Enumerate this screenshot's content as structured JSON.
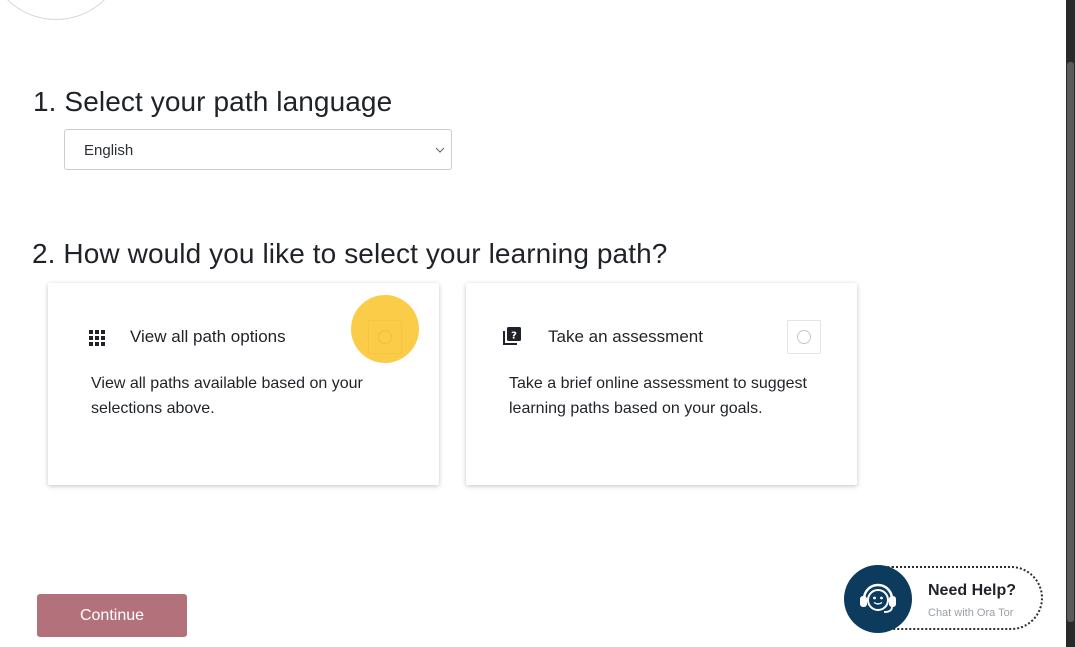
{
  "section1": {
    "title": "1. Select your path language",
    "language_select": {
      "value": "English"
    }
  },
  "section2": {
    "title": "2. How would you like to select your learning path?",
    "options": [
      {
        "title": "View all path options",
        "description": "View all paths available based on your selections above.",
        "icon": "grid-icon",
        "selected": false
      },
      {
        "title": "Take an assessment",
        "description": "Take a brief online assessment to suggest learning paths based on your goals.",
        "icon": "question-book-icon",
        "selected": false
      }
    ]
  },
  "actions": {
    "continue_label": "Continue"
  },
  "help": {
    "title": "Need Help?",
    "subtitle": "Chat with Ora Tor",
    "icon": "headset-chat-icon"
  },
  "colors": {
    "continue_bg": "#b3727b",
    "help_avatar": "#0d3b5e",
    "click_highlight": "#f9be14"
  }
}
